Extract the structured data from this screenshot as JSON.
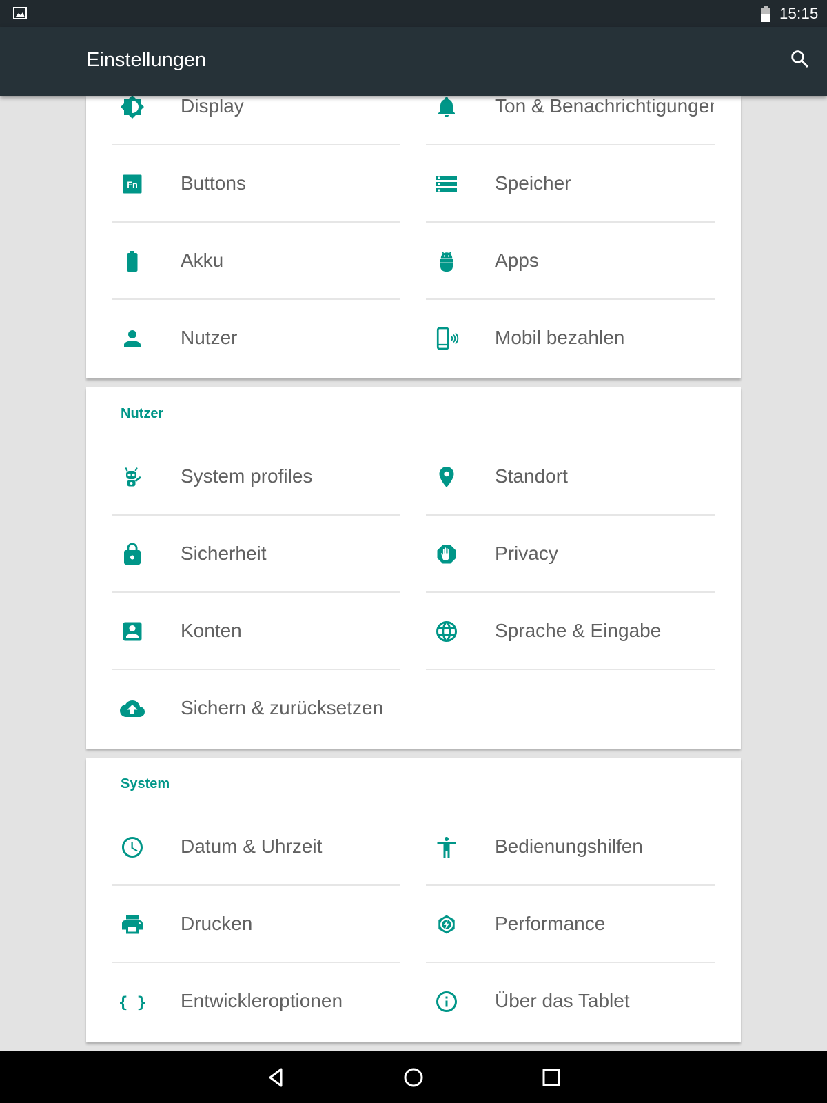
{
  "status_bar": {
    "time": "15:15"
  },
  "app_bar": {
    "title": "Einstellungen"
  },
  "card_top": {
    "items": [
      {
        "label": "Display",
        "icon": "brightness-icon"
      },
      {
        "label": "Ton & Benachrichtigungen",
        "icon": "bell-icon"
      },
      {
        "label": "Buttons",
        "icon": "fn-key-icon"
      },
      {
        "label": "Speicher",
        "icon": "storage-icon"
      },
      {
        "label": "Akku",
        "icon": "battery-icon"
      },
      {
        "label": "Apps",
        "icon": "android-icon"
      },
      {
        "label": "Nutzer",
        "icon": "person-icon"
      },
      {
        "label": "Mobil bezahlen",
        "icon": "tap-pay-icon"
      }
    ]
  },
  "section_nutzer": {
    "title": "Nutzer",
    "items": [
      {
        "label": "System profiles",
        "icon": "profiles-icon"
      },
      {
        "label": "Standort",
        "icon": "location-pin-icon"
      },
      {
        "label": "Sicherheit",
        "icon": "lock-icon"
      },
      {
        "label": "Privacy",
        "icon": "privacy-hand-icon"
      },
      {
        "label": "Konten",
        "icon": "account-box-icon"
      },
      {
        "label": "Sprache & Eingabe",
        "icon": "globe-icon"
      },
      {
        "label": "Sichern & zurücksetzen",
        "icon": "cloud-upload-icon"
      }
    ]
  },
  "section_system": {
    "title": "System",
    "items": [
      {
        "label": "Datum & Uhrzeit",
        "icon": "clock-icon"
      },
      {
        "label": "Bedienungshilfen",
        "icon": "accessibility-icon"
      },
      {
        "label": "Drucken",
        "icon": "printer-icon"
      },
      {
        "label": "Performance",
        "icon": "performance-icon"
      },
      {
        "label": "Entwickleroptionen",
        "icon": "braces-icon"
      },
      {
        "label": "Über das Tablet",
        "icon": "info-icon"
      }
    ]
  },
  "colors": {
    "accent": "#009688",
    "app_bar": "#263238",
    "status_bar": "#21292e",
    "background": "#e3e3e3",
    "text": "#616161"
  }
}
